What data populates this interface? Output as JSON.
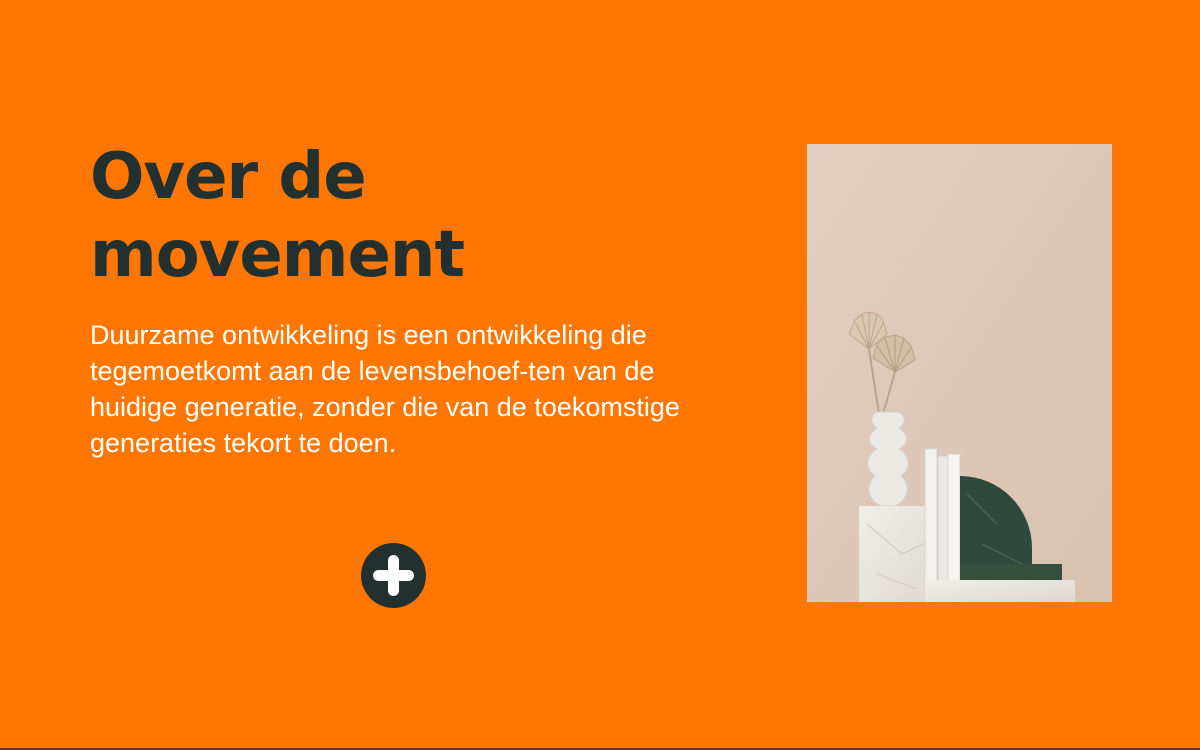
{
  "section": {
    "title_line1": "Over de",
    "title_line2": "movement",
    "body": "Duurzame ontwikkeling is een ontwikkeling die tegemoetkomt aan de levensbehoef-ten van de huidige generatie, zonder die van de toekomstige generaties tekort te doen."
  },
  "expand_button": {
    "icon": "plus-icon"
  },
  "photo": {
    "subject": "interior-decor-photo"
  },
  "colors": {
    "background": "#ff7700",
    "title": "#22312f",
    "body_text": "#ffffff",
    "button": "#22312f"
  }
}
